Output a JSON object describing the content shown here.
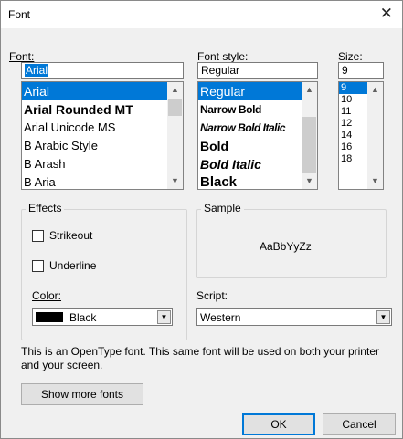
{
  "window": {
    "title": "Font",
    "close_glyph": "✕"
  },
  "font": {
    "label": "Font:",
    "value": "Arial",
    "items": [
      {
        "label": "Arial",
        "selected": true
      },
      {
        "label": "Arial Rounded MT"
      },
      {
        "label": "Arial Unicode MS"
      },
      {
        "label": "B Arabic Style"
      },
      {
        "label": "B Arash"
      },
      {
        "label": "B Aria"
      }
    ]
  },
  "style": {
    "label": "Font style:",
    "value": "Regular",
    "items": [
      {
        "label": "Regular",
        "selected": true
      },
      {
        "label": "Narrow Bold"
      },
      {
        "label": "Narrow Bold Italic"
      },
      {
        "label": "Bold"
      },
      {
        "label": "Bold Italic"
      },
      {
        "label": "Black"
      }
    ]
  },
  "size": {
    "label": "Size:",
    "value": "9",
    "items": [
      "9",
      "10",
      "11",
      "12",
      "14",
      "16",
      "18"
    ]
  },
  "effects": {
    "title": "Effects",
    "strikeout": {
      "label": "Strikeout",
      "checked": false
    },
    "underline": {
      "label": "Underline",
      "checked": false
    },
    "color_label": "Color:",
    "color_value": "Black",
    "color_hex": "#000000"
  },
  "sample": {
    "title": "Sample",
    "text": "AaBbYyZz"
  },
  "script": {
    "label": "Script:",
    "value": "Western"
  },
  "info": "This is an OpenType font. This same font will be used on both your printer and your screen.",
  "buttons": {
    "show_more": "Show more fonts",
    "ok": "OK",
    "cancel": "Cancel"
  },
  "colors": {
    "accent": "#0078d7",
    "dialog_bg": "#f0f0f0"
  }
}
